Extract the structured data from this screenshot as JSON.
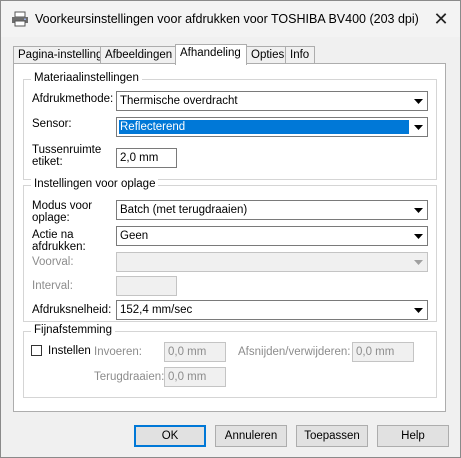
{
  "window": {
    "title": "Voorkeursinstellingen voor afdrukken voor TOSHIBA BV400 (203 dpi)",
    "close_glyph": "✕"
  },
  "tabs": [
    {
      "label": "Pagina-instelling"
    },
    {
      "label": "Afbeeldingen"
    },
    {
      "label": "Afhandeling",
      "active": true
    },
    {
      "label": "Opties"
    },
    {
      "label": "Info"
    }
  ],
  "material": {
    "title": "Materiaalinstellingen",
    "print_method_label": "Afdrukmethode:",
    "print_method_value": "Thermische overdracht",
    "sensor_label": "Sensor:",
    "sensor_value": "Reflecterend",
    "gap_label_line1": "Tussenruimte",
    "gap_label_line2": "etiket:",
    "gap_value": "2,0 mm"
  },
  "batch": {
    "title": "Instellingen voor oplage",
    "mode_label_line1": "Modus voor",
    "mode_label_line2": "oplage:",
    "mode_value": "Batch (met terugdraaien)",
    "action_label_line1": "Actie na",
    "action_label_line2": "afdrukken:",
    "action_value": "Geen",
    "condition_label": "Voorval:",
    "condition_value": "",
    "interval_label": "Interval:",
    "interval_value": "",
    "speed_label": "Afdruksnelheid:",
    "speed_value": "152,4 mm/sec"
  },
  "finetune": {
    "title": "Fijnafstemming",
    "enable_label": "Instellen",
    "feed_label": "Invoeren:",
    "feed_value": "0,0 mm",
    "cut_label": "Afsnijden/verwijderen:",
    "cut_value": "0,0 mm",
    "backfeed_label": "Terugdraaien:",
    "backfeed_value": "0,0 mm"
  },
  "buttons": {
    "ok": "OK",
    "cancel": "Annuleren",
    "apply": "Toepassen",
    "help": "Help"
  },
  "colors": {
    "selection": "#0078d7",
    "window_bg": "#f0f0f0"
  }
}
